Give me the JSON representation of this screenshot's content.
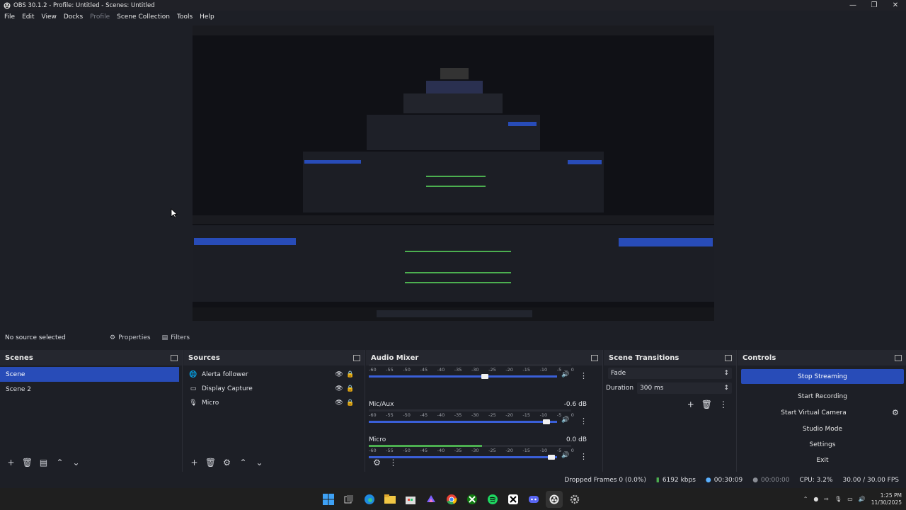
{
  "window": {
    "title": "OBS 30.1.2 - Profile: Untitled - Scenes: Untitled"
  },
  "menu": [
    "File",
    "Edit",
    "View",
    "Docks",
    "Profile",
    "Scene Collection",
    "Tools",
    "Help"
  ],
  "source_toolbar": {
    "no_source": "No source selected",
    "properties": "Properties",
    "filters": "Filters"
  },
  "scenes": {
    "title": "Scenes",
    "items": [
      "Scene",
      "Scene 2"
    ],
    "selected": 0
  },
  "sources": {
    "title": "Sources",
    "items": [
      {
        "name": "Alerta follower",
        "icon": "browser-icon"
      },
      {
        "name": "Display Capture",
        "icon": "monitor-icon"
      },
      {
        "name": "Micro",
        "icon": "microphone-icon"
      }
    ]
  },
  "mixer": {
    "title": "Audio Mixer",
    "channels": [
      {
        "name": "",
        "db": "",
        "volume": 0.62
      },
      {
        "name": "Mic/Aux",
        "db": "-0.6 dB",
        "volume": 0.96
      },
      {
        "name": "Micro",
        "db": "0.0 dB",
        "volume": 0.99
      }
    ],
    "ticks": [
      "-60",
      "-55",
      "-50",
      "-45",
      "-40",
      "-35",
      "-30",
      "-25",
      "-20",
      "-15",
      "-10",
      "-5",
      "0"
    ]
  },
  "transitions": {
    "title": "Scene Transitions",
    "selected": "Fade",
    "duration_label": "Duration",
    "duration_value": "300 ms"
  },
  "controls": {
    "title": "Controls",
    "stop_streaming": "Stop Streaming",
    "start_recording": "Start Recording",
    "start_virtual_camera": "Start Virtual Camera",
    "studio_mode": "Studio Mode",
    "settings": "Settings",
    "exit": "Exit"
  },
  "status": {
    "dropped": "Dropped Frames 0 (0.0%)",
    "bitrate": "6192 kbps",
    "stream_time": "00:30:09",
    "rec_time": "00:00:00",
    "cpu": "CPU: 3.2%",
    "fps": "30.00 / 30.00 FPS"
  },
  "clock": {
    "time": "1:25 PM",
    "date": "11/30/2025"
  },
  "colors": {
    "accent": "#284cb8",
    "bg": "#1d1f26",
    "panel_head": "#25272f",
    "meter_green": "#4caf50"
  }
}
